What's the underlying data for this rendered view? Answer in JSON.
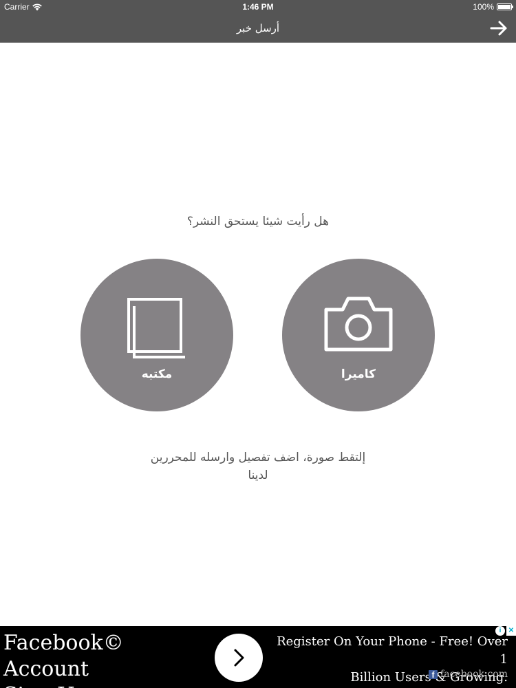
{
  "status_bar": {
    "carrier": "Carrier",
    "time": "1:46 PM",
    "battery": "100%"
  },
  "nav": {
    "title": "أرسل خبر",
    "back_icon": "arrow-right-icon"
  },
  "main": {
    "prompt": "هل رأيت شيئا يستحق النشر؟",
    "camera_label": "كاميرا",
    "library_label": "مكتبه",
    "instructions_line1": "إلتقط صورة، اضف تفصيل وارسله للمحررين",
    "instructions_line2": "لدينا"
  },
  "ad": {
    "headline_line1": "Facebook© Account",
    "headline_line2": "Sign Up »",
    "body_line1": "Register On Your Phone - Free! Over 1",
    "body_line2": "Billion Users & Growing.",
    "source": "facebook.com",
    "fb_letter": "f",
    "info_glyph": "i",
    "close_glyph": "✕"
  },
  "colors": {
    "bar": "#555555",
    "circle": "#858285",
    "text": "#555555",
    "ad_background": "#000000"
  }
}
